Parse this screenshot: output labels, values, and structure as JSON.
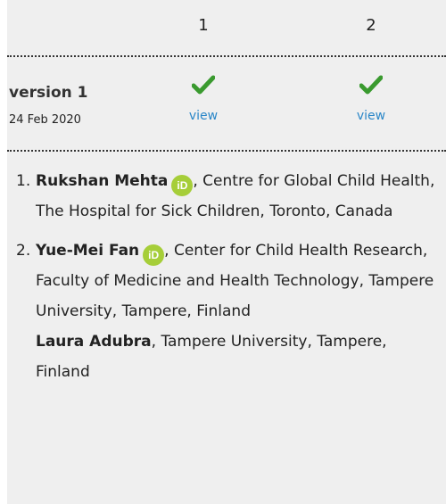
{
  "reviewer_columns": [
    "1",
    "2"
  ],
  "version": {
    "title": "version 1",
    "date": "24 Feb 2020",
    "statuses": [
      {
        "icon": "check-icon",
        "link": "view"
      },
      {
        "icon": "check-icon",
        "link": "view"
      }
    ]
  },
  "authors": [
    {
      "number": "1.",
      "name": "Rukshan Mehta",
      "orcid_icon": "orcid-icon",
      "affiliation": ", Centre for Global Child Health, The Hospital for Sick Children, Toronto, Canada"
    },
    {
      "number": "2.",
      "name": "Yue-Mei Fan",
      "orcid_icon": "orcid-icon",
      "affiliation": ", Center for Child Health Research, Faculty of Medicine and Health Technology, Tampere University, Tampere, Finland"
    }
  ],
  "co_reviewer": {
    "name": "Laura Adubra",
    "affiliation": ", Tampere University, Tampere, Finland"
  },
  "colors": {
    "accent_link": "#2b87c8",
    "check": "#3a9a2f",
    "orcid": "#a6ce39",
    "panel_bg": "#efefef"
  }
}
